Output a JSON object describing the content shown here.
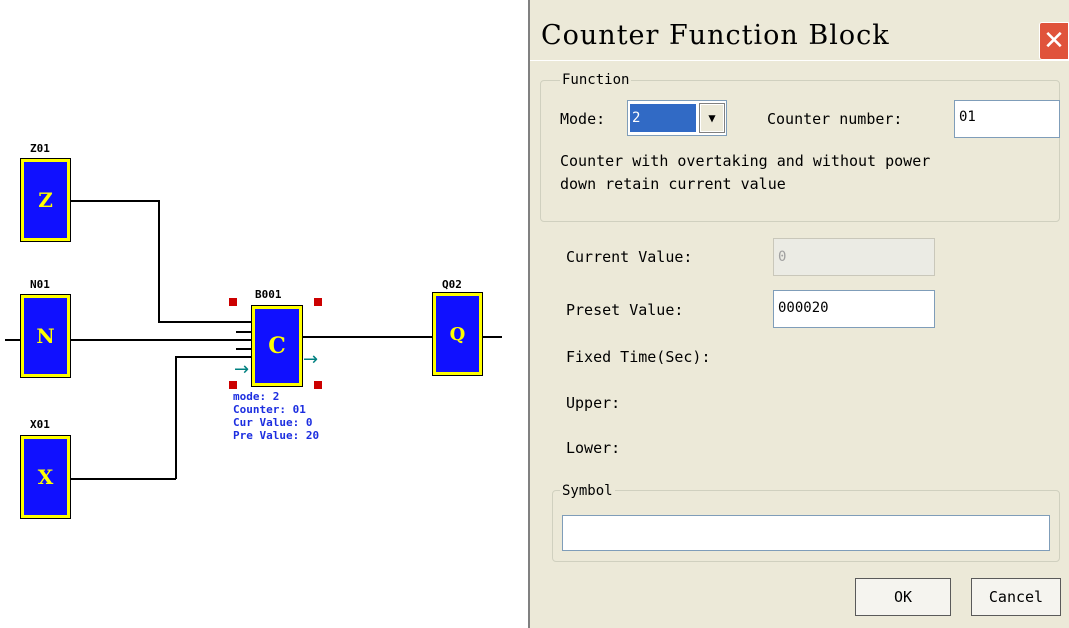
{
  "diagram": {
    "blocks": [
      {
        "id": "Z01",
        "letter": "Z"
      },
      {
        "id": "N01",
        "letter": "N"
      },
      {
        "id": "X01",
        "letter": "X"
      },
      {
        "id": "B001",
        "letter": "C"
      },
      {
        "id": "Q02",
        "letter": "Q"
      }
    ],
    "info": {
      "mode": "mode: 2",
      "counter": "Counter: 01",
      "cur_value": "Cur Value: 0",
      "pre_value": "Pre Value: 20"
    }
  },
  "dialog": {
    "title": "Counter Function Block",
    "close_icon": "close-icon",
    "function_group": {
      "legend": "Function",
      "mode_label": "Mode:",
      "mode_value": "2",
      "counter_number_label": "Counter number:",
      "counter_number_value": "01",
      "description_line1": "Counter with overtaking and without power",
      "description_line2": "down retain current value"
    },
    "current_value_label": "Current Value:",
    "current_value": "0",
    "preset_value_label": "Preset Value:",
    "preset_value": "000020",
    "fixed_time_label": "Fixed Time(Sec):",
    "upper_label": "Upper:",
    "lower_label": "Lower:",
    "symbol_group": {
      "legend": "Symbol",
      "value": ""
    },
    "ok_label": "OK",
    "cancel_label": "Cancel"
  },
  "colors": {
    "block_fill": "#1010ff",
    "block_border": "#ffff00",
    "info_text": "#1c2ee0",
    "close_button": "#e0533b",
    "selection": "#316ac5"
  }
}
